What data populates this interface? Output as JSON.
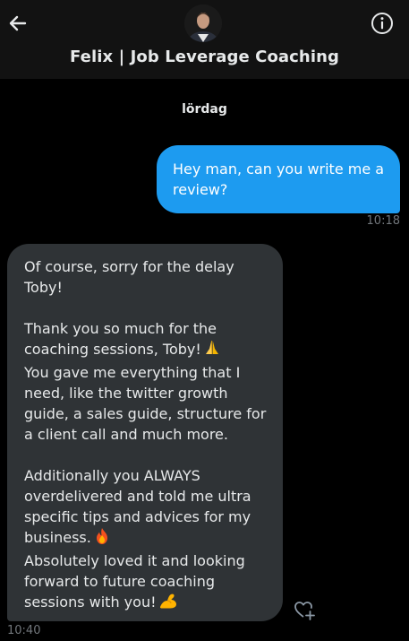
{
  "header": {
    "title": "Felix | Job Leverage Coaching",
    "back_icon": "arrow-left-icon",
    "info_icon": "info-circle-icon"
  },
  "conversation": {
    "day_separator": "lördag",
    "outgoing": {
      "lines": [
        "Hey man, can you write me a",
        "review?"
      ],
      "time": "10:18"
    },
    "incoming": {
      "para1": [
        "Of course, sorry for the delay",
        "Toby!"
      ],
      "para2": [
        "Thank you so much for the",
        "coaching sessions, Toby!",
        "You gave me everything that I",
        "need, like the twitter growth",
        "guide, a sales guide, structure for",
        "a client call and much more."
      ],
      "para3": [
        "Additionally you ALWAYS",
        "overdelivered and told me ultra",
        "specific tips and advices for my",
        "business.",
        "Absolutely loved it and looking",
        "forward to future coaching",
        "sessions with you!"
      ],
      "emoji": [
        "folded-hands-emoji",
        "fire-emoji",
        "flexed-biceps-emoji"
      ],
      "time": "10:40"
    },
    "react_icon": "heart-plus-icon"
  },
  "colors": {
    "background": "#000000",
    "header_bg": "#121212",
    "outgoing_bubble": "#1d9bf0",
    "incoming_bubble": "#2f3336",
    "text": "#e7e9ea",
    "muted": "#71767b"
  }
}
